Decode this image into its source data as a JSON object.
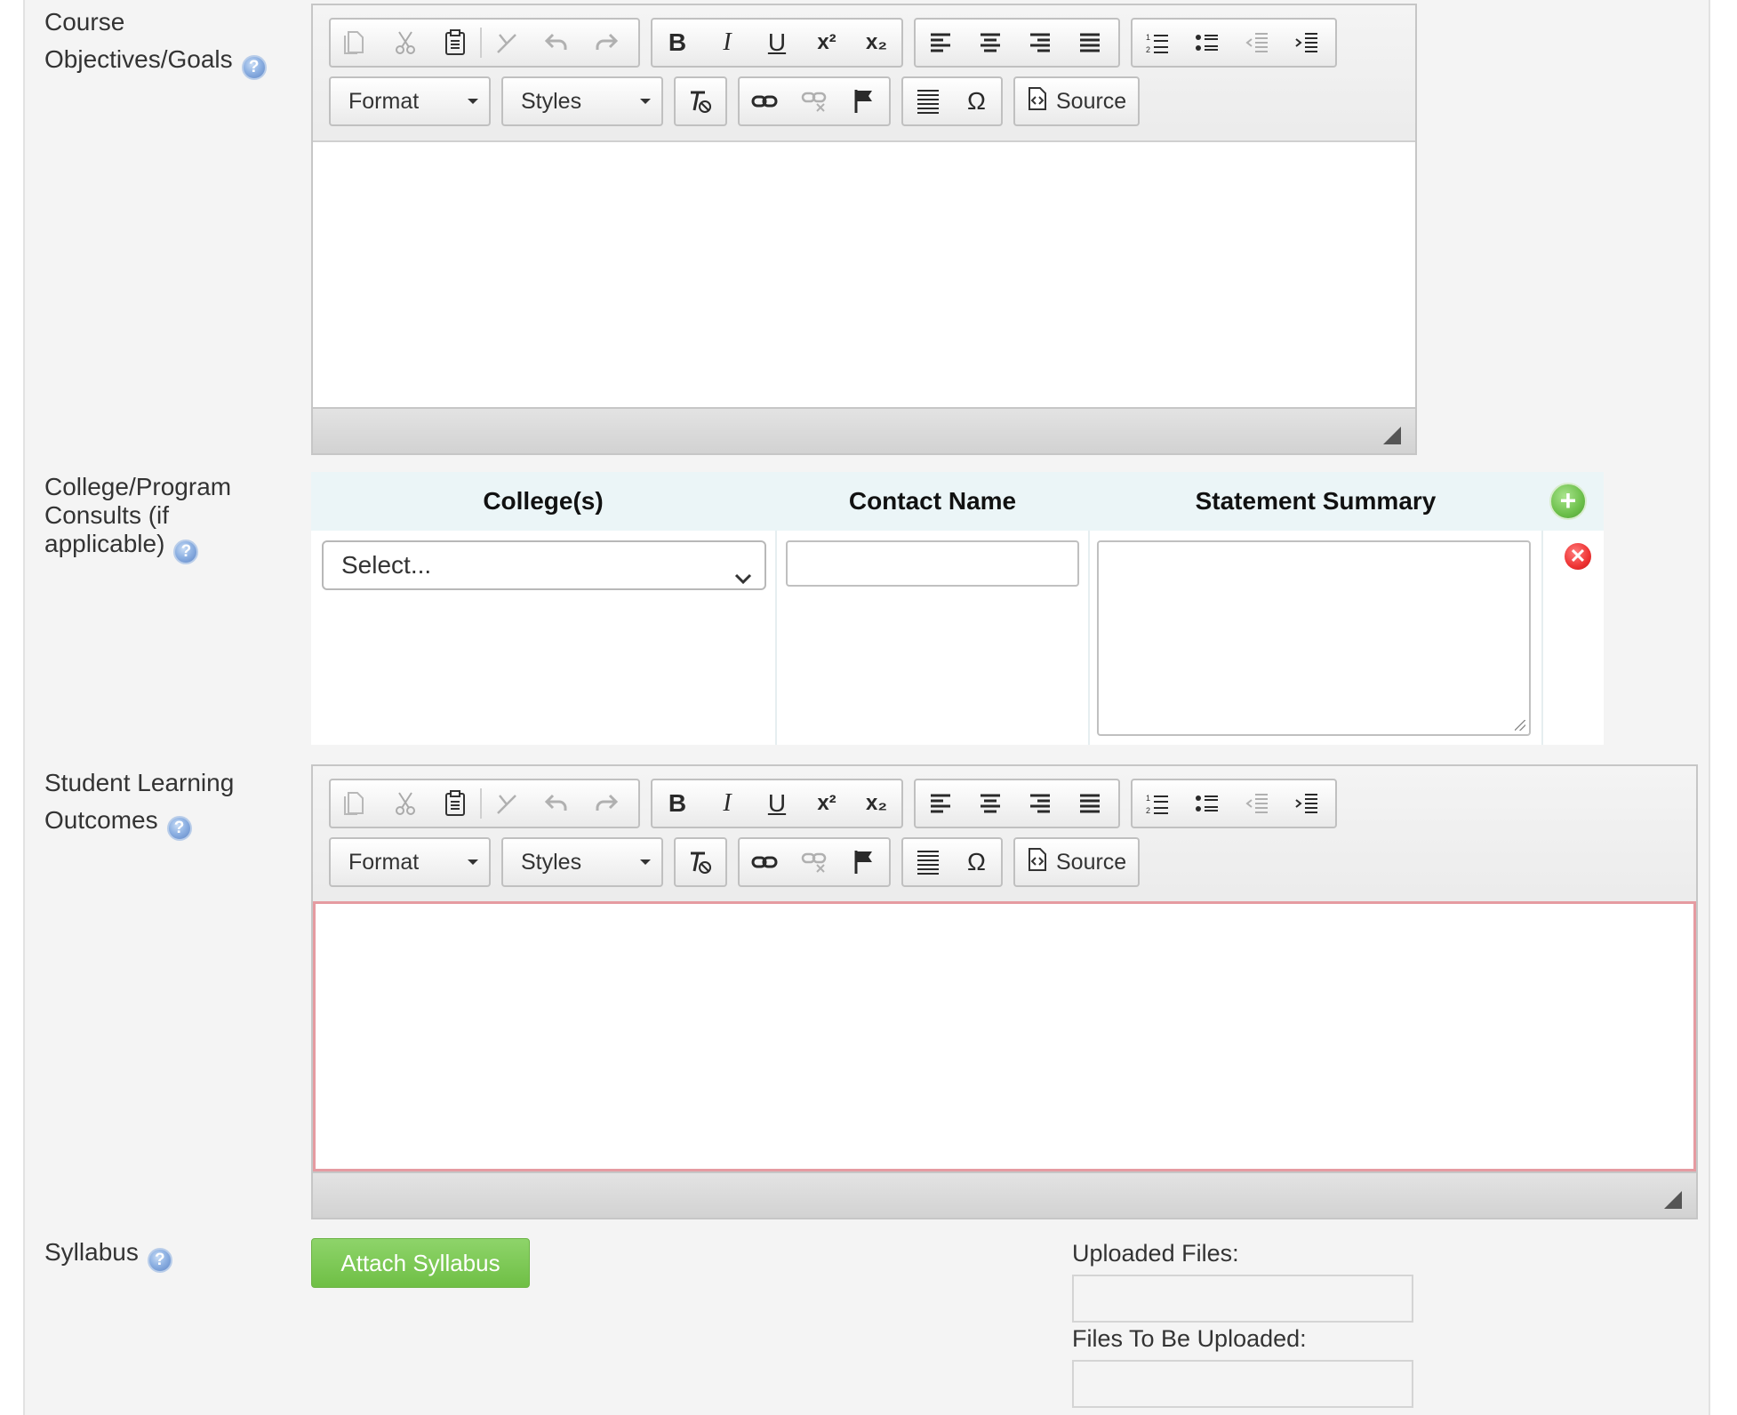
{
  "fields": {
    "course_objectives": {
      "label": "Course Objectives/Goals",
      "line1": "Course",
      "line2": "Objectives/Goals"
    },
    "consults": {
      "line1": "College/Program",
      "line2": "Consults (if",
      "line3": "applicable)"
    },
    "learning_outcomes": {
      "line1": "Student Learning",
      "line2": "Outcomes"
    },
    "syllabus": {
      "label": "Syllabus"
    }
  },
  "help_icon_glyph": "?",
  "toolbar": {
    "format_label": "Format",
    "styles_label": "Styles",
    "source_label": "Source",
    "icons": {
      "copy": "copy-icon",
      "cut": "cut-icon",
      "paste": "paste-icon",
      "remove_format": "remove-format-icon",
      "undo": "undo-icon",
      "redo": "redo-icon",
      "bold": "bold-icon",
      "italic": "italic-icon",
      "underline": "underline-icon",
      "superscript": "superscript-icon",
      "subscript": "subscript-icon",
      "align_left": "align-left-icon",
      "align_center": "align-center-icon",
      "align_right": "align-right-icon",
      "justify": "justify-icon",
      "numbered_list": "numbered-list-icon",
      "bulleted_list": "bulleted-list-icon",
      "outdent": "outdent-icon",
      "indent": "indent-icon",
      "clear_formatting": "clear-formatting-icon",
      "link": "link-icon",
      "unlink": "unlink-icon",
      "anchor": "anchor-flag-icon",
      "horizontal_rule": "horizontal-rule-icon",
      "special_char": "omega-icon",
      "source": "source-icon"
    },
    "glyphs": {
      "bold": "B",
      "italic": "I",
      "underline": "U",
      "superscript": "x²",
      "subscript": "x₂",
      "omega": "Ω"
    }
  },
  "consults_table": {
    "headers": [
      "College(s)",
      "Contact Name",
      "Statement Summary"
    ],
    "college_select_value": "Select...",
    "contact_name_value": "",
    "statement_summary_value": ""
  },
  "syllabus": {
    "attach_button": "Attach Syllabus",
    "uploaded_files_label": "Uploaded Files:",
    "files_to_upload_label": "Files To Be Uploaded:"
  },
  "colors": {
    "attach_button": "#78c64f",
    "add_button": "#6cbf4a",
    "remove_button": "#e33333",
    "required_border": "#e59ba1",
    "table_header_bg": "#ebf5f7"
  }
}
